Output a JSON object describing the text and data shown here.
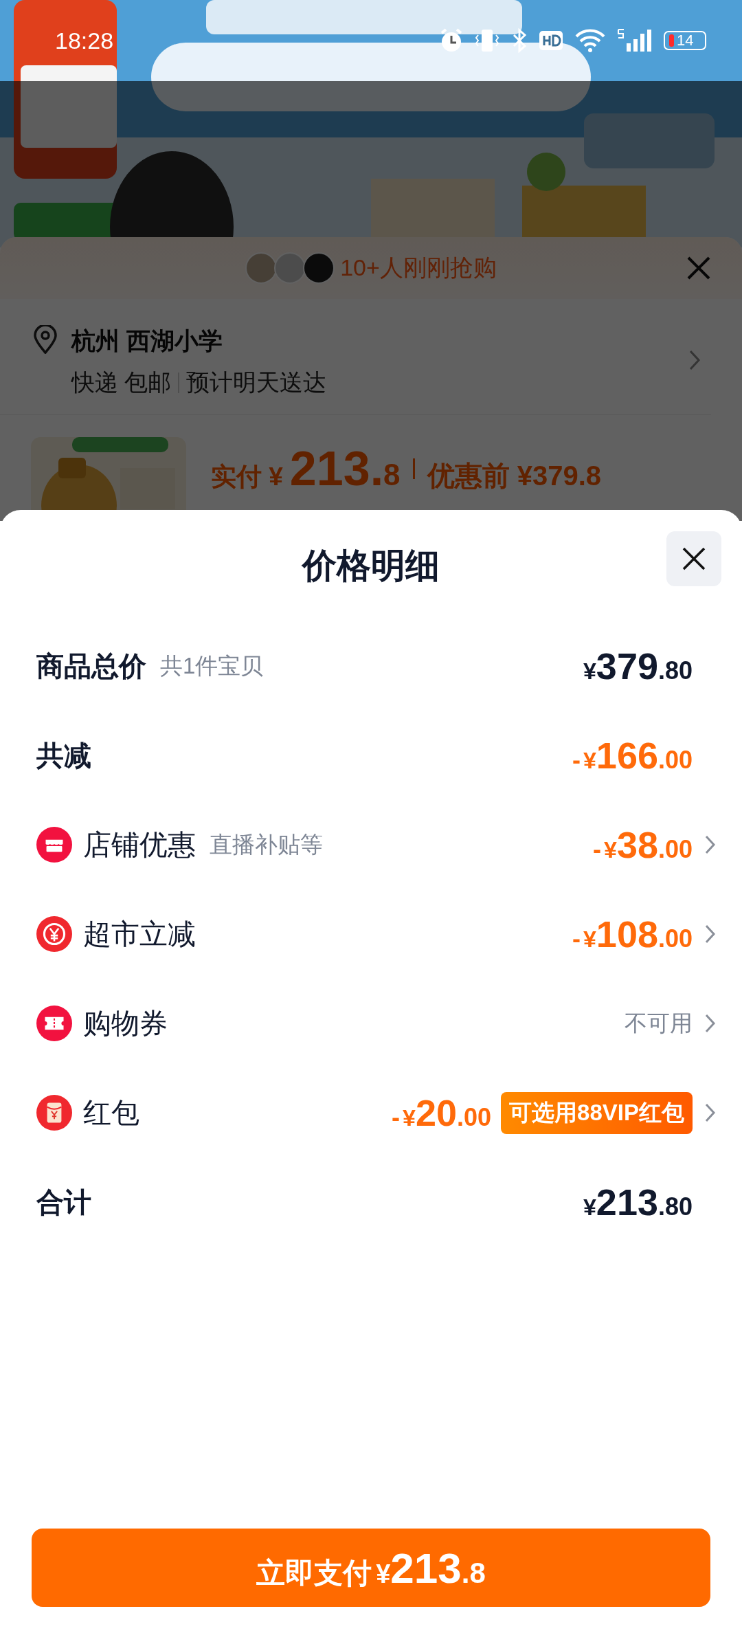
{
  "status_bar": {
    "time": "18:28",
    "battery": "14"
  },
  "background_sheet": {
    "buyers_text": "10+人刚刚抢购",
    "address": {
      "title": "杭州 西湖小学",
      "shipping": "快递 包邮",
      "eta": "预计明天送达"
    },
    "price": {
      "label": "实付",
      "currency": "¥",
      "integer": "213.",
      "decimal": "8",
      "original_label": "优惠前",
      "original": "¥379.8"
    }
  },
  "price_detail": {
    "title": "价格明细",
    "rows": [
      {
        "kind": "summary",
        "label": "商品总价",
        "note": "共1件宝贝",
        "sign": "",
        "currency": "¥",
        "integer": "379",
        "decimal": ".80",
        "highlight": false,
        "has_detail": false
      },
      {
        "kind": "summary",
        "label": "共减",
        "sign": "-",
        "currency": "¥",
        "integer": "166",
        "decimal": ".00",
        "highlight": true,
        "has_detail": false
      },
      {
        "kind": "store",
        "label": "店铺优惠",
        "note": "直播补贴等",
        "sign": "-",
        "currency": "¥",
        "integer": "38",
        "decimal": ".00",
        "highlight": true,
        "has_detail": true
      },
      {
        "kind": "instant",
        "label": "超市立减",
        "sign": "-",
        "currency": "¥",
        "integer": "108",
        "decimal": ".00",
        "highlight": true,
        "has_detail": true
      },
      {
        "kind": "coupon",
        "label": "购物券",
        "status": "不可用",
        "has_detail": true
      },
      {
        "kind": "redpacket",
        "label": "红包",
        "sign": "-",
        "currency": "¥",
        "integer": "20",
        "decimal": ".00",
        "highlight": true,
        "badge": "可选用88VIP红包",
        "has_detail": true
      },
      {
        "kind": "summary",
        "label": "合计",
        "sign": "",
        "currency": "¥",
        "integer": "213",
        "decimal": ".80",
        "highlight": false,
        "has_detail": false
      }
    ]
  },
  "pay_button": {
    "label": "立即支付",
    "currency": "¥",
    "integer": "213",
    "decimal": ".8"
  }
}
